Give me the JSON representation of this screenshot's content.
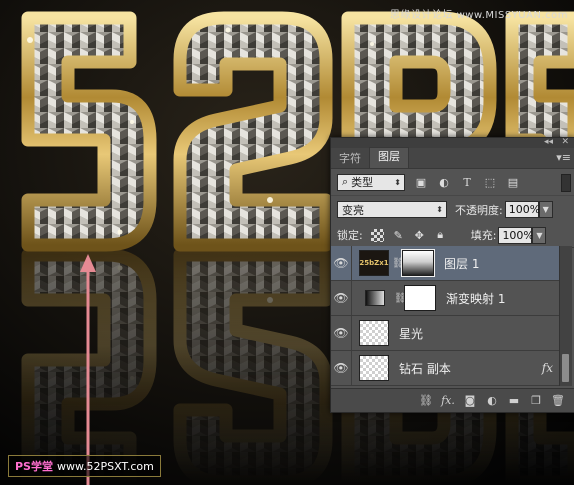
{
  "watermark_top": "思缘设计论坛 www.MISSYUAN.com",
  "watermark_bottom": {
    "ps": "PS学堂",
    "site": "www.52PSXT.com"
  },
  "panel": {
    "tabs": [
      {
        "label": "字符"
      },
      {
        "label": "图层"
      }
    ],
    "active_tab": "图层",
    "filter": {
      "value": "类型",
      "icons": [
        "image-filter-icon",
        "adjustment-filter-icon",
        "type-filter-icon",
        "shape-filter-icon",
        "smart-object-filter-icon"
      ]
    },
    "blend_mode": "变亮",
    "opacity_label": "不透明度:",
    "opacity_value": "100%",
    "lock_label": "锁定:",
    "fill_label": "填充:",
    "fill_value": "100%",
    "layers": [
      {
        "name": "图层 1",
        "thumb_text": "25bZx1",
        "selected": true,
        "fx": ""
      },
      {
        "name": "渐变映射 1",
        "selected": false,
        "fx": ""
      },
      {
        "name": "星光",
        "selected": false,
        "fx": ""
      },
      {
        "name": "钻石 副本",
        "selected": false,
        "fx": "fx"
      }
    ],
    "footer_buttons": [
      "link-layers-icon",
      "fx-icon",
      "add-mask-icon",
      "adjustment-icon",
      "folder-icon",
      "new-layer-icon",
      "trash-icon"
    ],
    "footer_fx_label": "fx."
  },
  "colors": {
    "gold": "#c9a24a",
    "panel": "#535353",
    "selected": "#5f6a7a",
    "arrow": "#e58a93"
  }
}
